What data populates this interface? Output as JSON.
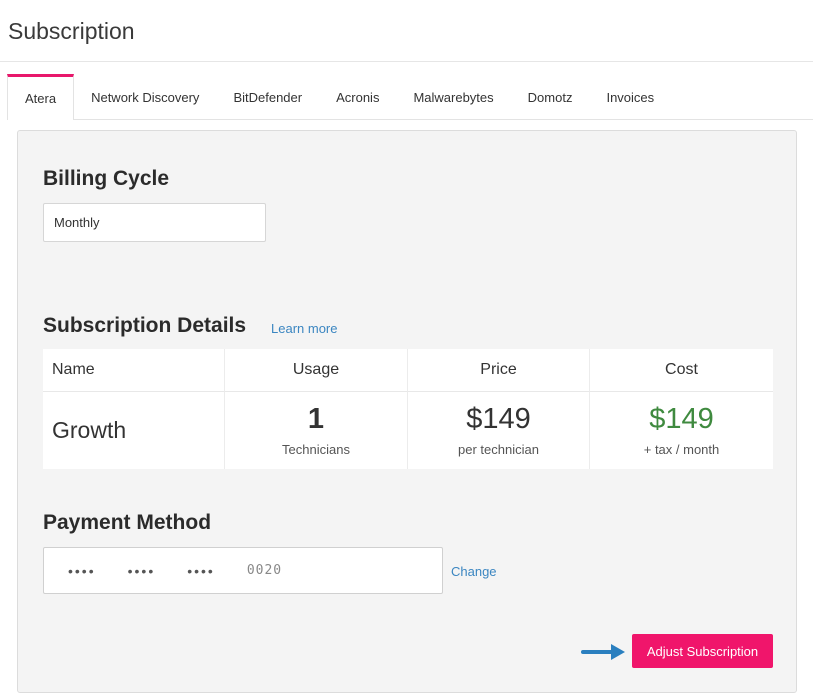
{
  "page": {
    "title": "Subscription"
  },
  "tabs": [
    {
      "label": "Atera",
      "active": true
    },
    {
      "label": "Network Discovery",
      "active": false
    },
    {
      "label": "BitDefender",
      "active": false
    },
    {
      "label": "Acronis",
      "active": false
    },
    {
      "label": "Malwarebytes",
      "active": false
    },
    {
      "label": "Domotz",
      "active": false
    },
    {
      "label": "Invoices",
      "active": false
    }
  ],
  "billing": {
    "heading": "Billing Cycle",
    "selected": "Monthly"
  },
  "details": {
    "heading": "Subscription Details",
    "learn_more": "Learn more",
    "columns": [
      "Name",
      "Usage",
      "Price",
      "Cost"
    ],
    "row": {
      "name": "Growth",
      "usage": "1",
      "usage_label": "Technicians",
      "price": "$149",
      "price_label": "per technician",
      "cost": "$149",
      "cost_label": "+ tax / month"
    }
  },
  "payment": {
    "heading": "Payment Method",
    "card_groups": [
      "••••",
      "••••",
      "••••"
    ],
    "card_last": "0020",
    "change_label": "Change"
  },
  "actions": {
    "adjust_label": "Adjust Subscription"
  },
  "colors": {
    "accent": "#e8176b",
    "button": "#f0156b",
    "link": "#3b86c1",
    "cost_green": "#3f8a3f",
    "arrow": "#2a7fbf"
  },
  "icons": {
    "arrow": "arrow-right-icon"
  }
}
